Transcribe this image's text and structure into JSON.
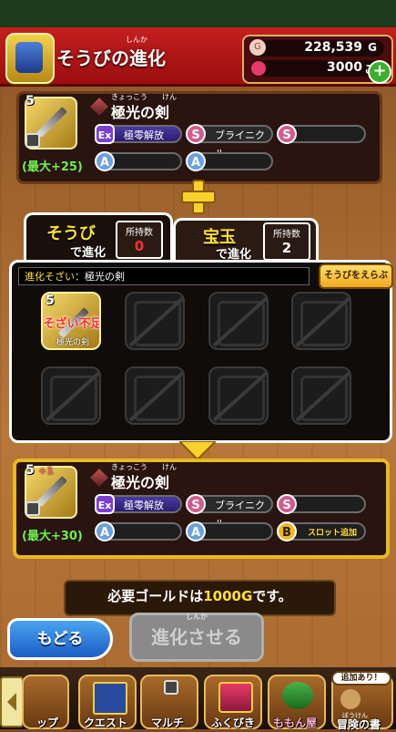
{
  "header": {
    "title": "そうびの進化",
    "title_ruby": "しんか",
    "gold": "228,539",
    "gold_unit": "G",
    "gems": "3000",
    "gems_unit": "こ"
  },
  "source_item": {
    "level": "5",
    "name": "極光の剣",
    "name_ruby_1": "きょっこう",
    "name_ruby_2": "けん",
    "max_label": "(最大+25)",
    "skills": [
      {
        "badge": "Ex",
        "text": "極零解放"
      },
      {
        "badge": "S",
        "text": "ブライニクル"
      },
      {
        "badge": "S",
        "text": ""
      },
      {
        "badge": "A",
        "text": ""
      },
      {
        "badge": "A",
        "text": ""
      }
    ]
  },
  "tabs": [
    {
      "title": "そうび",
      "subtitle": "で進化",
      "count_label": "所持数",
      "count": "0"
    },
    {
      "title": "宝玉",
      "subtitle": "で進化",
      "count_label": "所持数",
      "count": "2"
    }
  ],
  "materials": {
    "bar_label": "進化そざい：",
    "bar_value": "極光の剣",
    "select_button": "そうびをえらぶ",
    "slot1_level": "5",
    "slot1_status": "そざい不足",
    "slot1_name": "極光の剣"
  },
  "result_item": {
    "level": "5",
    "plus": "+1",
    "name": "極光の剣",
    "name_ruby_1": "きょっこう",
    "name_ruby_2": "けん",
    "max_label": "(最大+30)",
    "skills": [
      {
        "badge": "Ex",
        "text": "極零解放"
      },
      {
        "badge": "S",
        "text": "ブライニクル"
      },
      {
        "badge": "S",
        "text": ""
      },
      {
        "badge": "A",
        "text": ""
      },
      {
        "badge": "A",
        "text": ""
      },
      {
        "badge": "B",
        "text": "スロット追加"
      }
    ]
  },
  "gold_required": {
    "prefix": "必要ゴールドは",
    "amount": "1000G",
    "suffix": "です。"
  },
  "buttons": {
    "back": "もどる",
    "evolve": "進化させる",
    "evolve_ruby": "しんか"
  },
  "nav": {
    "items": [
      "ップ",
      "クエスト",
      "マルチ",
      "ふくびき",
      "ももん屋",
      "冒険の書"
    ],
    "badge": "追加あり！",
    "ruby_last": "ぼうけん"
  }
}
